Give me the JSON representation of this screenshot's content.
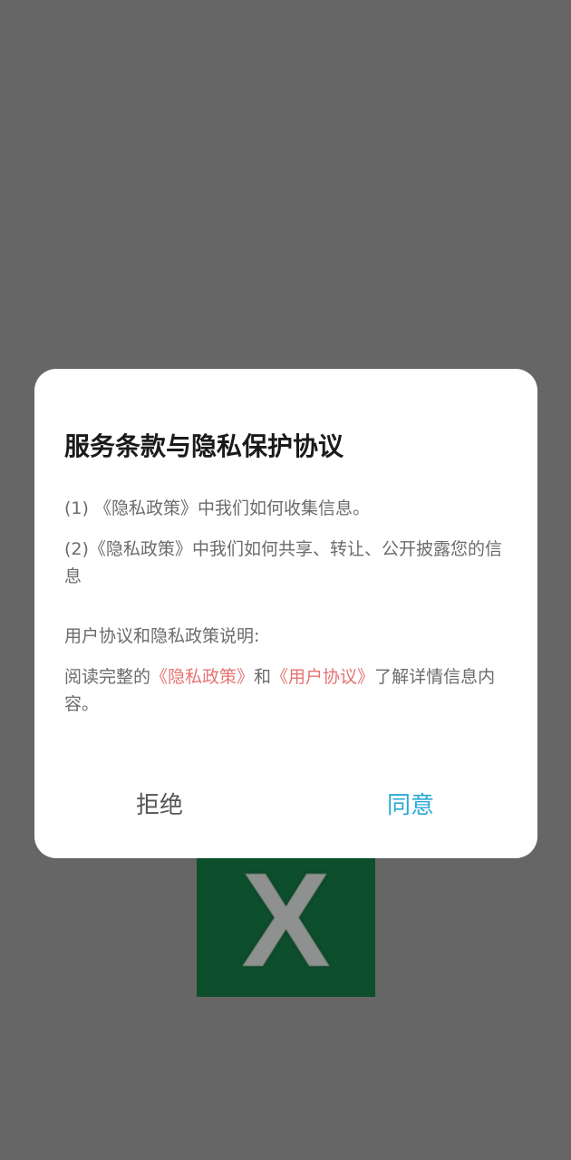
{
  "background": {
    "app_icon_letter": "X",
    "app_icon_color": "#0d4f2c"
  },
  "dialog": {
    "title": "服务条款与隐私保护协议",
    "items": [
      {
        "prefix": "(1) ",
        "link": "《隐私政策》",
        "suffix": "中我们如何收集信息。"
      },
      {
        "prefix": "(2)",
        "link": "《隐私政策》",
        "suffix": "中我们如何共享、转让、公开披露您的信息"
      }
    ],
    "section_heading": "用户协议和隐私政策说明:",
    "reading_note": {
      "prefix": "阅读完整的",
      "privacy_link": "《隐私政策》",
      "middle": "和",
      "terms_link": "《用户协议》",
      "suffix": "了解详情信息内容。"
    },
    "buttons": {
      "reject": "拒绝",
      "agree": "同意"
    },
    "colors": {
      "link": "#e57373",
      "agree": "#2aa9d6",
      "overlay": "#666666"
    }
  }
}
